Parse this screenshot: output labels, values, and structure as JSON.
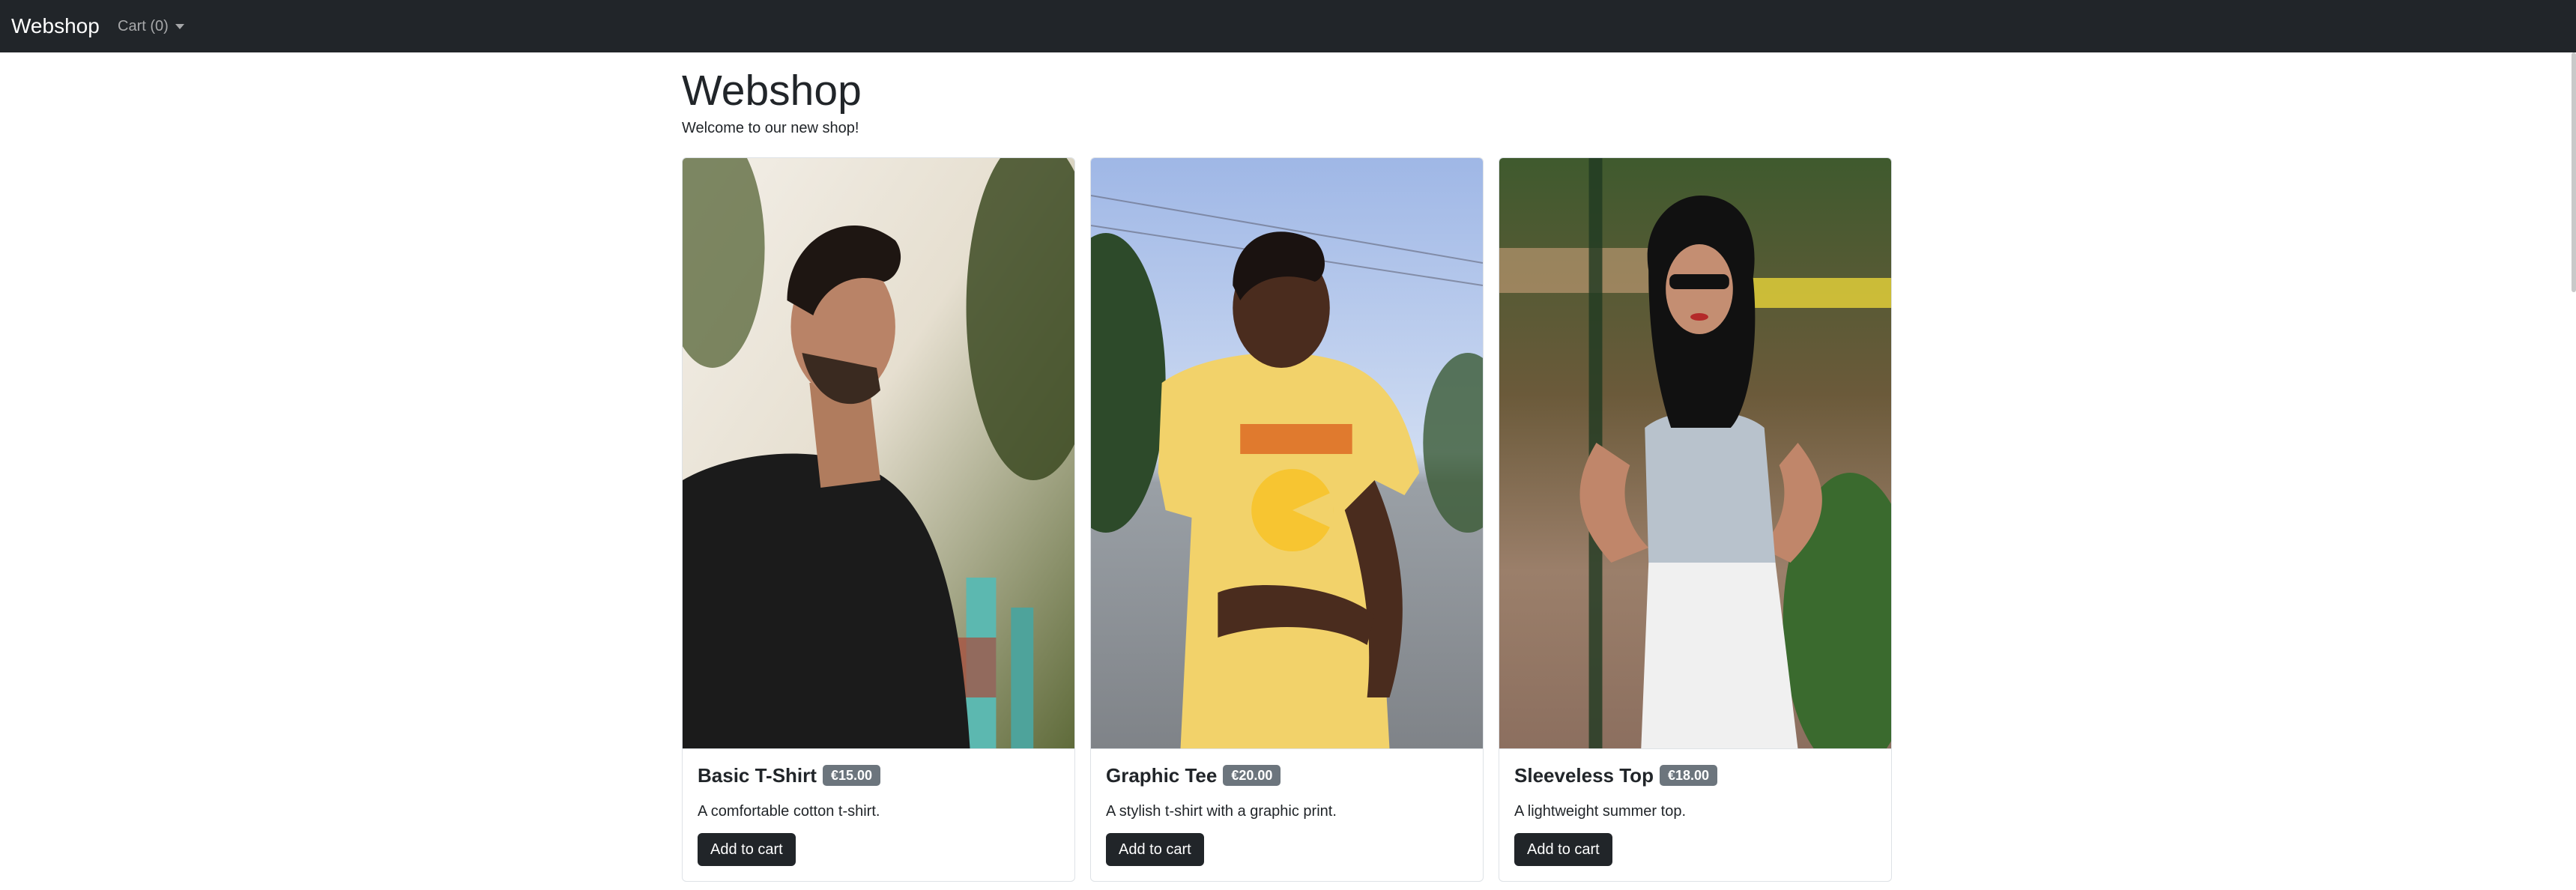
{
  "navbar": {
    "brand": "Webshop",
    "cart_label": "Cart (0)"
  },
  "page": {
    "title": "Webshop",
    "lead": "Welcome to our new shop!"
  },
  "products": [
    {
      "name": "Basic T-Shirt",
      "price": "€15.00",
      "description": "A comfortable cotton t-shirt.",
      "button": "Add to cart"
    },
    {
      "name": "Graphic Tee",
      "price": "€20.00",
      "description": "A stylish t-shirt with a graphic print.",
      "button": "Add to cart"
    },
    {
      "name": "Sleeveless Top",
      "price": "€18.00",
      "description": "A lightweight summer top.",
      "button": "Add to cart"
    }
  ],
  "colors": {
    "navbar_bg": "#212529",
    "badge_bg": "#6c757d",
    "button_bg": "#212529"
  },
  "icons": {
    "cart_toggle": "caret-down-icon"
  }
}
